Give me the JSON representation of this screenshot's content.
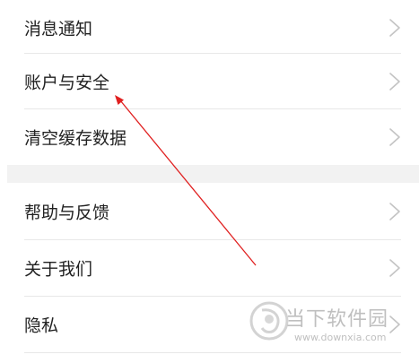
{
  "settings": {
    "items": [
      {
        "label": "消息通知"
      },
      {
        "label": "账户与安全"
      },
      {
        "label": "清空缓存数据"
      },
      {
        "label": "帮助与反馈"
      },
      {
        "label": "关于我们"
      },
      {
        "label": "隐私"
      }
    ]
  },
  "annotation": {
    "arrow_color": "#e02020"
  },
  "watermark": {
    "brand": "当下软件园",
    "url": "www.downxia.com"
  }
}
